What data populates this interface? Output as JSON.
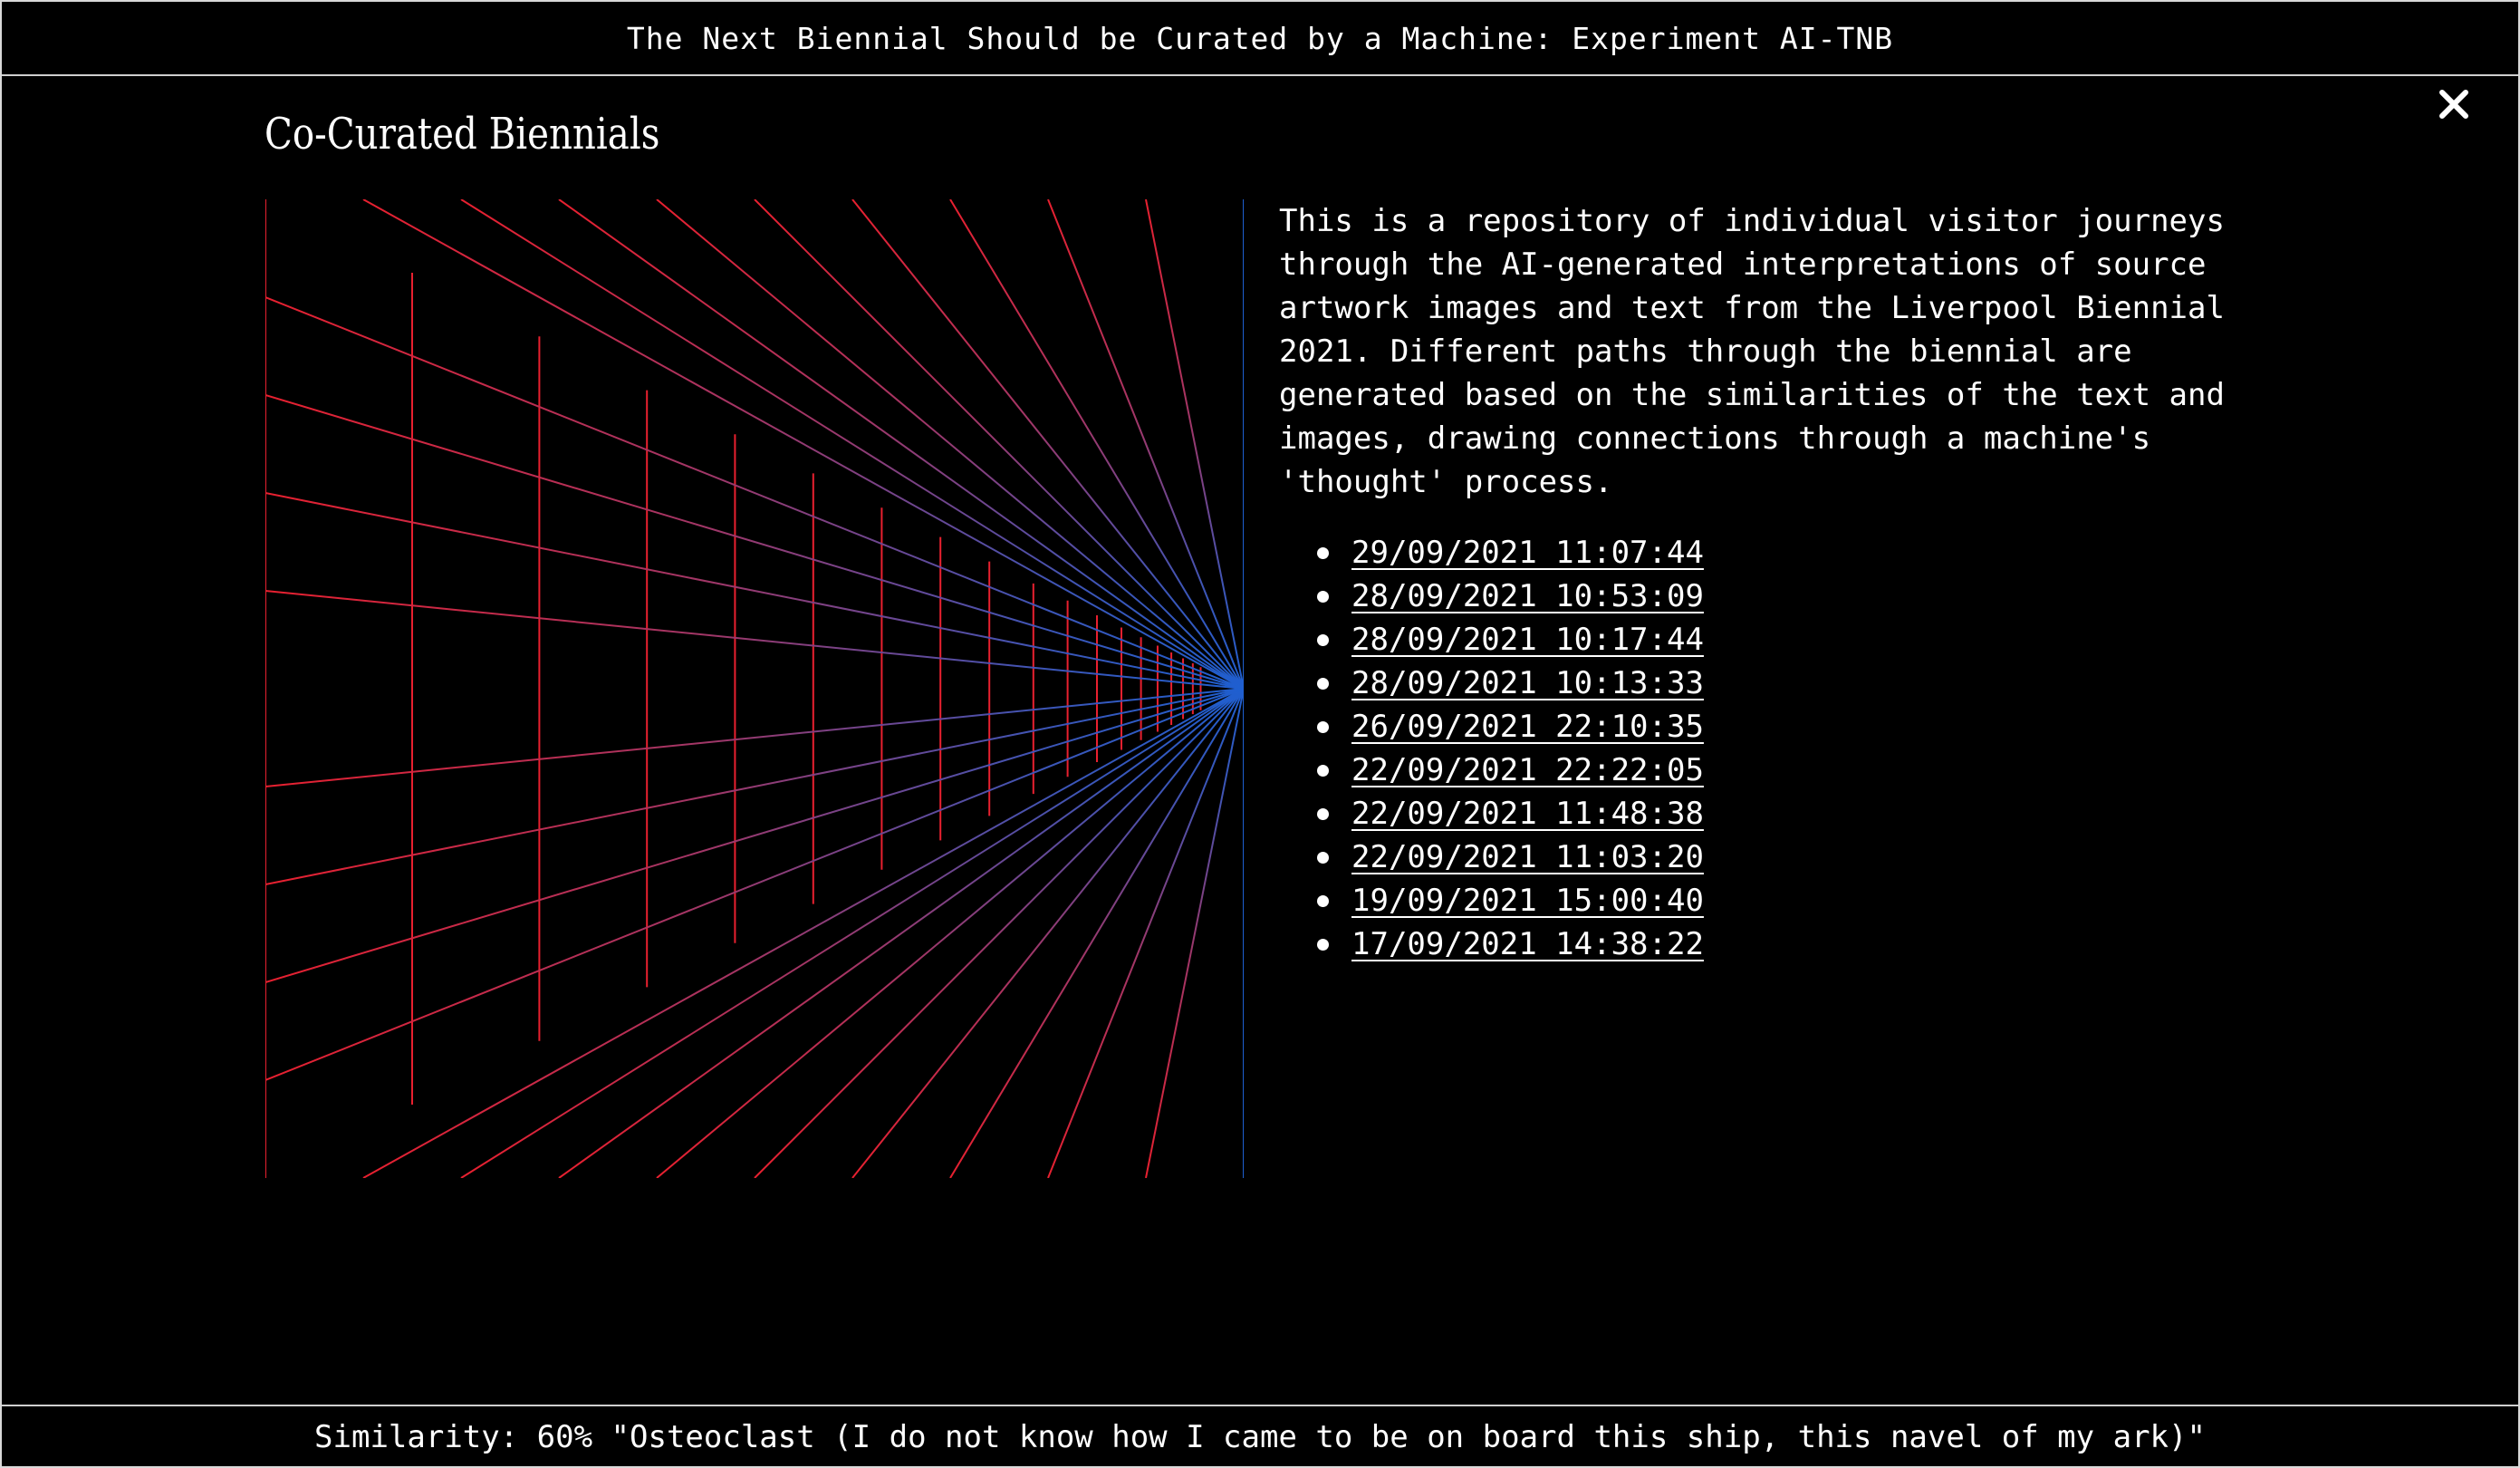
{
  "header": {
    "title": "The Next Biennial Should be Curated by a Machine: Experiment AI-TNB"
  },
  "close_icon": "close-icon",
  "section": {
    "title": "Co-Curated Biennials",
    "description": "This is a repository of individual visitor journeys through the AI-generated interpretations of source artwork images and text from the Liverpool Biennial 2021. Different paths through the biennial are generated based on the similarities of the text and images, drawing connections through a machine's 'thought' process."
  },
  "journeys": [
    "29/09/2021 11:07:44",
    "28/09/2021 10:53:09",
    "28/09/2021 10:17:44",
    "28/09/2021 10:13:33",
    "26/09/2021 22:10:35",
    "22/09/2021 22:22:05",
    "22/09/2021 11:48:38",
    "22/09/2021 11:03:20",
    "19/09/2021 15:00:40",
    "17/09/2021 14:38:22"
  ],
  "footer": {
    "status": "Similarity: 60% \"Osteoclast (I do not know how I came to be on board this ship, this navel of my ark)\""
  },
  "colors": {
    "background": "#000000",
    "text": "#ffffff",
    "tunnel_near": "#e8202f",
    "tunnel_far": "#1e5fd0"
  }
}
